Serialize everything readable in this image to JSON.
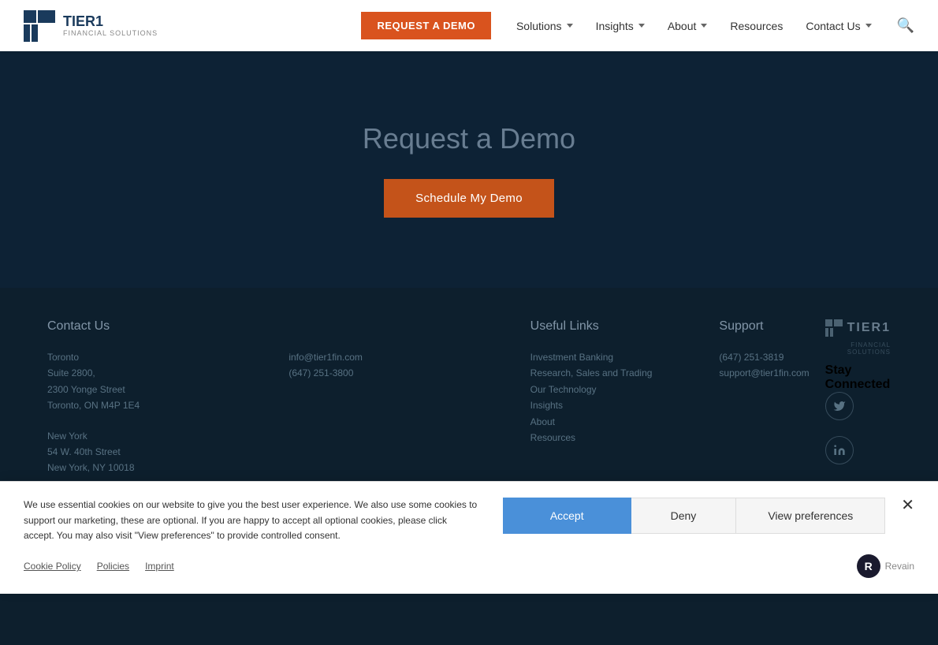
{
  "nav": {
    "logo_brand": "TIER1",
    "logo_sub": "FINANCIAL SOLUTIONS",
    "cta_label": "REQUEST A DEMO",
    "links": [
      {
        "id": "solutions",
        "label": "Solutions",
        "has_dropdown": true
      },
      {
        "id": "insights",
        "label": "Insights",
        "has_dropdown": true
      },
      {
        "id": "about",
        "label": "About",
        "has_dropdown": true
      },
      {
        "id": "resources",
        "label": "Resources",
        "has_dropdown": false
      },
      {
        "id": "contact",
        "label": "Contact Us",
        "has_dropdown": true
      }
    ]
  },
  "hero": {
    "title": "Request a Demo",
    "schedule_btn": "Schedule My Demo"
  },
  "footer": {
    "contact_title": "Contact Us",
    "toronto_label": "Toronto",
    "toronto_addr": "Suite 2800,\n2300 Yonge Street\nToronto, ON M4P 1E4",
    "toronto_email": "info@tier1fin.com",
    "toronto_phone": "(647) 251-3800",
    "newyork_label": "New York",
    "newyork_addr": "54 W. 40th Street\nNew York, NY 10018",
    "useful_title": "Useful Links",
    "useful_links": [
      "Investment Banking",
      "Research, Sales and Trading",
      "Our Technology",
      "Insights",
      "About",
      "Resources"
    ],
    "support_title": "Support",
    "support_phone": "(647) 251-3819",
    "support_email": "support@tier1fin.com",
    "stay_title": "Stay Connected",
    "footer_brand": "TIER1",
    "footer_brand_sub": "FINANCIAL SOLUTIONS"
  },
  "cookie": {
    "message": "We use essential cookies on our website to give you the best user experience. We also use some cookies to support our marketing, these are optional. If you are happy to accept all optional cookies, please click accept. You may also visit \"View preferences\" to provide controlled consent.",
    "accept_label": "Accept",
    "deny_label": "Deny",
    "prefs_label": "View preferences",
    "link_policy": "Cookie Policy",
    "link_policies": "Policies",
    "link_imprint": "Imprint",
    "revain_label": "Revain"
  }
}
